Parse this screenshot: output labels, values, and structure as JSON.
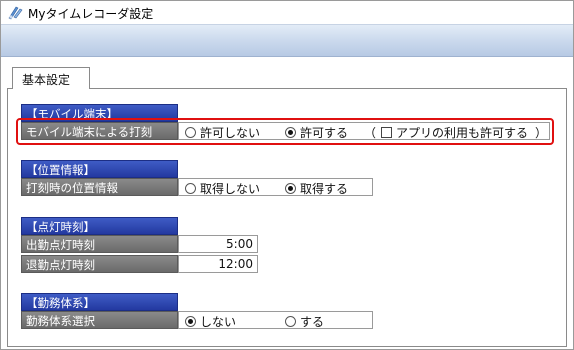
{
  "window": {
    "title": "Myタイムレコーダ設定",
    "icon": "app-icon"
  },
  "tabs": [
    {
      "label": "基本設定",
      "selected": true
    }
  ],
  "mobile": {
    "header": "【モバイル端末】",
    "label": "モバイル端末による打刻",
    "options": [
      {
        "label": "許可しない",
        "checked": false
      },
      {
        "label": "許可する",
        "checked": true
      }
    ],
    "paren_open": "（",
    "app_option": {
      "label": "アプリの利用も許可する",
      "checked": false
    },
    "paren_close": "）"
  },
  "location": {
    "header": "【位置情報】",
    "label": "打刻時の位置情報",
    "options": [
      {
        "label": "取得しない",
        "checked": false
      },
      {
        "label": "取得する",
        "checked": true
      }
    ]
  },
  "lighting": {
    "header": "【点灯時刻】",
    "rows": [
      {
        "label": "出勤点灯時刻",
        "value": "5:00"
      },
      {
        "label": "退勤点灯時刻",
        "value": "12:00"
      }
    ]
  },
  "worksystem": {
    "header": "【勤務体系】",
    "label": "勤務体系選択",
    "options": [
      {
        "label": "しない",
        "checked": true
      },
      {
        "label": "する",
        "checked": false
      }
    ]
  },
  "colors": {
    "section_header": "#2339a0",
    "field_label": "#7a7a7a",
    "highlight": "#e01010"
  }
}
